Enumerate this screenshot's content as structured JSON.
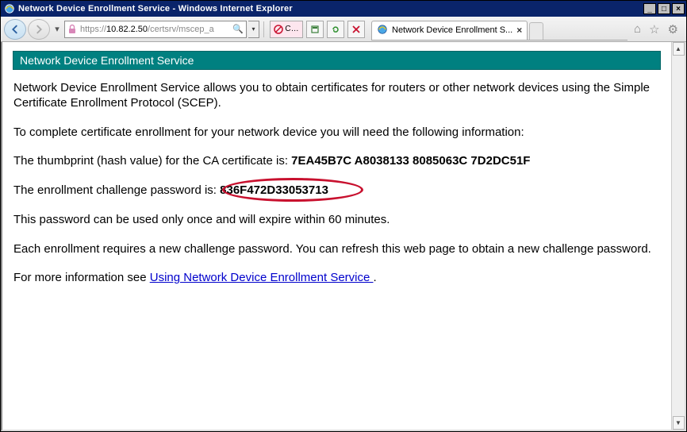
{
  "window": {
    "title": "Network Device Enrollment Service - Windows Internet Explorer"
  },
  "nav": {
    "url_scheme": "https://",
    "url_host": "10.82.2.50",
    "url_path": "/certsrv/mscep_a",
    "compat_label": "C…",
    "tab_title": "Network Device Enrollment S...",
    "tab_close": "×"
  },
  "page": {
    "header": "Network Device Enrollment Service",
    "p1": "Network Device Enrollment Service allows you to obtain certificates for routers or other network devices using the Simple Certificate Enrollment Protocol (SCEP).",
    "p2": "To complete certificate enrollment for your network device you will need the following information:",
    "p3_prefix": "The thumbprint (hash value) for the CA certificate is: ",
    "thumbprint": "7EA45B7C A8038133 8085063C 7D2DC51F",
    "p4_prefix": "The enrollment challenge password is: ",
    "challenge_password": "836F472D33053713",
    "p5": "This password can be used only once and will expire within 60 minutes.",
    "p6": "Each enrollment requires a new challenge password. You can refresh this web page to obtain a new challenge password.",
    "p7_prefix": "For more information see ",
    "link_text": "Using Network Device Enrollment Service ",
    "p7_suffix": "."
  }
}
